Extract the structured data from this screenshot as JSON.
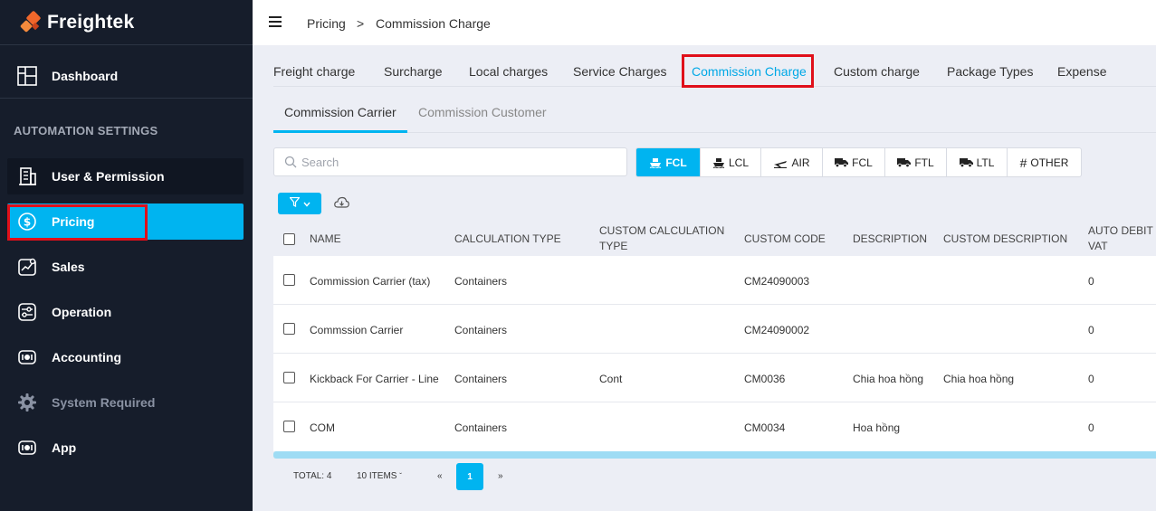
{
  "brand": {
    "name": "Freightek"
  },
  "sidebar": {
    "dashboard": "Dashboard",
    "section_title": "AUTOMATION SETTINGS",
    "items": [
      {
        "label": "User & Permission",
        "icon": "building-icon"
      },
      {
        "label": "Pricing",
        "icon": "dollar-icon"
      },
      {
        "label": "Sales",
        "icon": "sales-chart-icon"
      },
      {
        "label": "Operation",
        "icon": "operation-icon"
      },
      {
        "label": "Accounting",
        "icon": "accounting-icon"
      },
      {
        "label": "System Required",
        "icon": "gear-icon"
      },
      {
        "label": "App",
        "icon": "app-icon"
      }
    ]
  },
  "breadcrumb": {
    "parent": "Pricing",
    "separator": ">",
    "current": "Commission Charge"
  },
  "tabs": [
    "Freight charge",
    "Surcharge",
    "Local charges",
    "Service Charges",
    "Commission Charge",
    "Custom charge",
    "Package Types",
    "Expense"
  ],
  "subtabs": [
    "Commission Carrier",
    "Commission Customer"
  ],
  "search": {
    "placeholder": "Search"
  },
  "modes": [
    "FCL",
    "LCL",
    "AIR",
    "FCL",
    "FTL",
    "LTL",
    "OTHER"
  ],
  "table": {
    "columns": {
      "name": "NAME",
      "calc_type": "CALCULATION TYPE",
      "custom_calc_type_1": "CUSTOM CALCULATION",
      "custom_calc_type_2": "TYPE",
      "custom_code": "CUSTOM CODE",
      "description": "DESCRIPTION",
      "custom_description": "CUSTOM DESCRIPTION",
      "auto_debit_vat_1": "AUTO DEBIT",
      "auto_debit_vat_2": "VAT"
    },
    "rows": [
      {
        "name": "Commission Carrier (tax)",
        "calc_type": "Containers",
        "custom_calc_type": "",
        "custom_code": "CM24090003",
        "description": "",
        "custom_description": "",
        "auto_debit_vat": "0"
      },
      {
        "name": "Commssion Carrier",
        "calc_type": "Containers",
        "custom_calc_type": "",
        "custom_code": "CM24090002",
        "description": "",
        "custom_description": "",
        "auto_debit_vat": "0"
      },
      {
        "name": "Kickback For Carrier - Line",
        "calc_type": "Containers",
        "custom_calc_type": "Cont",
        "custom_code": "CM0036",
        "description": "Chia hoa hồng",
        "custom_description": "Chia hoa hồng",
        "auto_debit_vat": "0"
      },
      {
        "name": "COM",
        "calc_type": "Containers",
        "custom_calc_type": "",
        "custom_code": "CM0034",
        "description": "Hoa hồng",
        "custom_description": "",
        "auto_debit_vat": "0"
      }
    ]
  },
  "pagination": {
    "total": "TOTAL: 4",
    "page_size": "10 ITEMS",
    "prev": "«",
    "current": "1",
    "next": "»"
  },
  "colors": {
    "accent": "#00b4f0",
    "sidebar_bg": "#161d2b",
    "highlight": "#e0101a"
  }
}
